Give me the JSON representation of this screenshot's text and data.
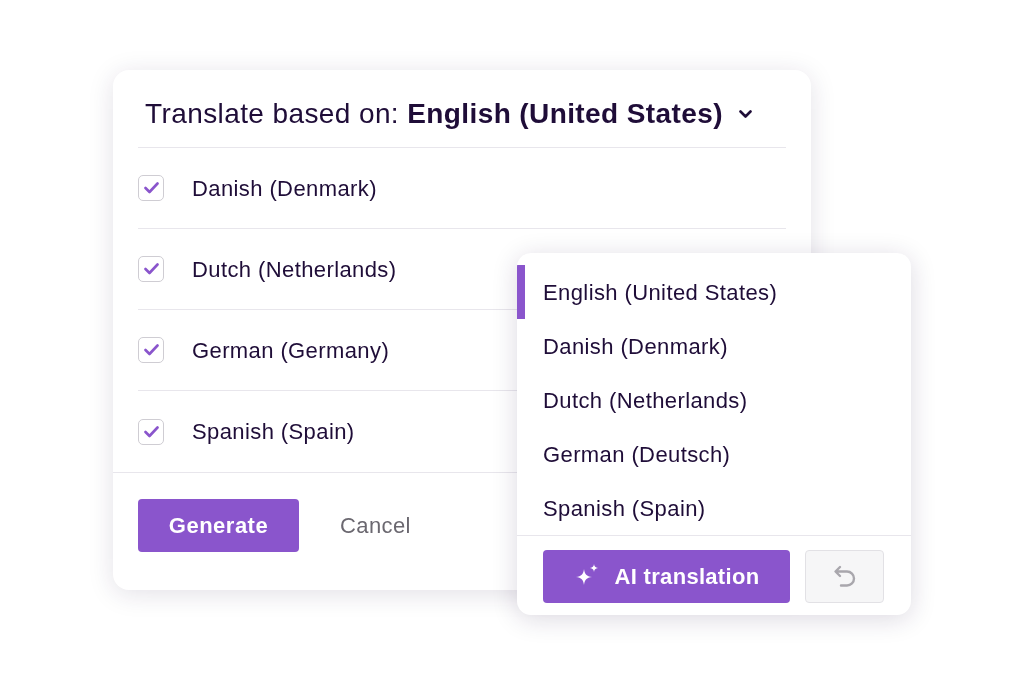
{
  "translate_dialog": {
    "source_selector": {
      "text": "Translate based on: **English (United States)**"
    },
    "languages": [
      {
        "label": "Danish (Denmark)",
        "checked": true
      },
      {
        "label": "Dutch (Netherlands)",
        "checked": true
      },
      {
        "label": "German (Germany)",
        "checked": true
      },
      {
        "label": "Spanish (Spain)",
        "checked": true
      }
    ],
    "buttons": [
      {
        "label": "Generate",
        "kind": "primary"
      },
      {
        "label": "Cancel",
        "kind": "text"
      }
    ]
  },
  "language_menu": {
    "items": [
      {
        "label": "English (United States)",
        "selected": true
      },
      {
        "label": "Danish (Denmark)",
        "selected": false
      },
      {
        "label": "Dutch (Netherlands)",
        "selected": false
      },
      {
        "label": "German (Deutsch)",
        "selected": false
      },
      {
        "label": "Spanish (Spain)",
        "selected": false
      }
    ],
    "ai_button": {
      "label": "AI translation"
    },
    "undo_button": {
      "disabled": true
    }
  }
}
